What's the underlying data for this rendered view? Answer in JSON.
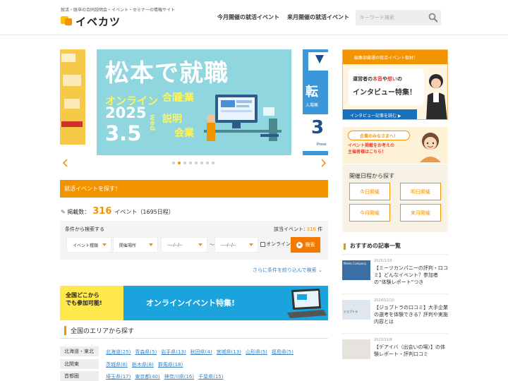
{
  "header": {
    "tagline": "就活・既卒の合同説明会・イベント・セミナーの情報サイト",
    "logo_text": "イベカツ",
    "nav": [
      "今月開催の就活イベント",
      "来月開催の就活イベント"
    ],
    "search_placeholder": "キーワード検索",
    "accent": "#f29400"
  },
  "carousel": {
    "main": {
      "title": "松本で就職",
      "online": "オンライン",
      "year": "2025",
      "date": "3.5",
      "weekday": "wed",
      "vertical_lines": [
        "合同",
        "説明",
        "企業",
        "会業"
      ],
      "bg": "#8fd6df"
    },
    "left_peek_text": "",
    "right_peek_text": "転",
    "right_peek_sub": "入場無",
    "right_peek_num": "3",
    "right_peek_small": "Prese",
    "dot_count": 8,
    "active_dot": 1
  },
  "search": {
    "bar_title": "就活イベントを探す！",
    "count_prefix": "掲載数：",
    "count": "316",
    "count_suffix": "イベント（1695日程）",
    "filter_label": "条件から検索する",
    "hit_label": "該当イベント:",
    "hit_count": "316",
    "hit_suffix": "件",
    "event_type": "イベント種類",
    "location": "開催場所",
    "date_from": "----/--/--",
    "tilde": "〜",
    "date_to": "----/--/--",
    "online_label": "オンライン",
    "search_button": "検索",
    "more_link": "さらに条件を絞り込んで検索 ⌄"
  },
  "online_banner": {
    "left_line1": "全国どこから",
    "left_line2": "でも参加可能!",
    "title": "オンラインイベント特集!"
  },
  "area": {
    "title": "全国のエリアから探す",
    "rows": [
      {
        "region": "北海道・東北",
        "prefs": [
          "北海道(25)",
          "青森県(5)",
          "岩手県(13)",
          "秋田県(4)",
          "宮城県(13)",
          "山形県(5)",
          "福島県(5)"
        ]
      },
      {
        "region": "北関東",
        "prefs": [
          "茨城県(8)",
          "栃木県(8)",
          "群馬県(18)"
        ]
      },
      {
        "region": "首都圏",
        "prefs": [
          "埼玉県(17)",
          "東京都(40)",
          "神奈川県(16)",
          "千葉県(15)"
        ]
      }
    ]
  },
  "sidebar": {
    "ad1": {
      "top_text": "編集部厳選の就活イベント取材！",
      "line1_a": "運営者の",
      "line1_hl1": "本音",
      "line1_b": "や",
      "line1_hl2": "想い",
      "line1_c": "の",
      "line2": "インタビュー特集！",
      "button": "インタビュー記事を読む ▶"
    },
    "ad2": {
      "tag": "企業のみなさまへ！",
      "line1": "イベント掲載をお考えの",
      "line2": "主催者様はこちら！"
    },
    "schedule": {
      "title": "開催日程から探す",
      "buttons": [
        "今日開催",
        "明日開催",
        "今月開催",
        "来月開催"
      ]
    },
    "recommend_title": "おすすめの記事一覧",
    "articles": [
      {
        "date": "2025/1/16",
        "title": "【ミーツカンパニーの評判・口コミ】どんなイベント？参加者の“体験レポート”つき",
        "thumb_text": "Meets Company"
      },
      {
        "date": "2024/12/10",
        "title": "【ジョブトラの口コミ】大手企業の選考を体験できる？評判や実施内容とは",
        "thumb_text": "ジョブトラ"
      },
      {
        "date": "2023/11/8",
        "title": "【デアイバ（出会いの場）】の体験レポート・評判口コミ",
        "thumb_text": ""
      }
    ]
  }
}
